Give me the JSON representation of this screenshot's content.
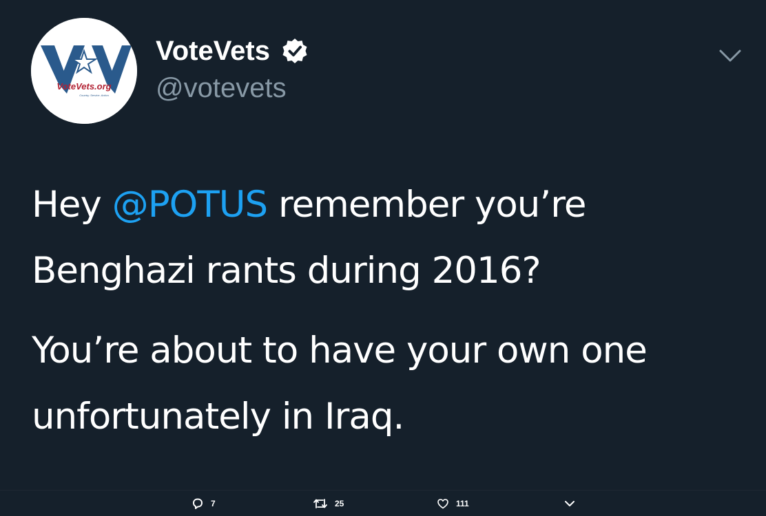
{
  "account": {
    "display_name": "VoteVets",
    "handle": "@votevets",
    "avatar_text": "VoteVets.org",
    "avatar_tagline": "Country. Service. Action."
  },
  "tweet": {
    "line1_prefix": "Hey ",
    "mention": "@POTUS",
    "line1_suffix": " remember you’re Benghazi rants during 2016?",
    "paragraph2": "You’re about to have your own one unfortunately in Iraq."
  },
  "actions": {
    "reply_count": "7",
    "retweet_count": "25",
    "like_count": "111"
  },
  "icons": {
    "verified": "verified-badge-icon",
    "caret": "chevron-down-icon",
    "reply": "reply-icon",
    "retweet": "retweet-icon",
    "like": "heart-icon",
    "share": "chevron-down-icon"
  },
  "colors": {
    "background": "#15202b",
    "text": "#ffffff",
    "secondary_text": "#8899a6",
    "mention": "#1da1f2",
    "logo_blue": "#2a5a8c",
    "logo_red": "#b22234"
  }
}
